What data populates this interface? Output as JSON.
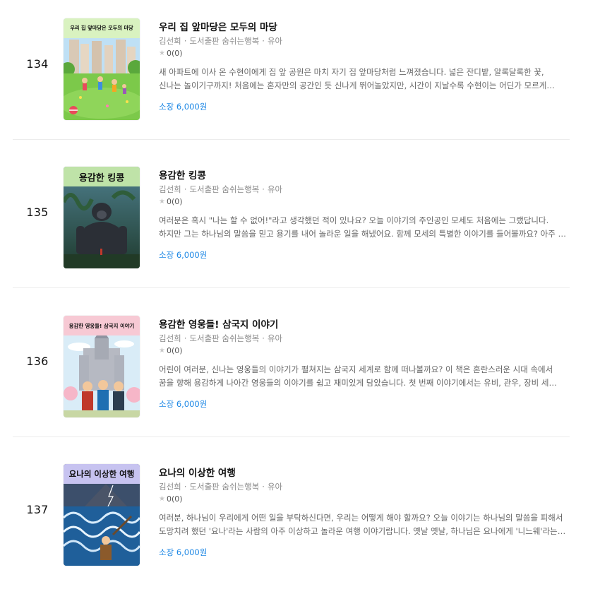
{
  "colors": {
    "accent": "#1e88e5",
    "meta": "#8a8a8a",
    "star_empty": "#c8c8c8",
    "band_green": "#bfe3a8",
    "band_pink": "#f7c9d4",
    "band_lavender": "#c7c3f0"
  },
  "books": [
    {
      "rank": "134",
      "title": "우리 집 앞마당은 모두의 마당",
      "author": "김선희",
      "publisher": "도서출판 숨쉬는행복",
      "category": "유아",
      "rating": "0(0)",
      "description": "새 아파트에 이사 온 수현이에게 집 앞 공원은 마치 자기 집 앞마당처럼 느껴졌습니다. 넓은 잔디밭, 알록달록한 꽃, 신나는 놀이기구까지! 처음에는 혼자만의 공간인 듯 신나게 뛰어놀았지만, 시간이 지날수록 수현이는 어딘가 모르게 심심함을…",
      "price": "소장 6,000원",
      "cover_title": "우리 집 앞마당은 모두의 마당",
      "cover_icon": "playground-illustration"
    },
    {
      "rank": "135",
      "title": "용감한 킹콩",
      "author": "김선희",
      "publisher": "도서출판 숨쉬는행복",
      "category": "유아",
      "rating": "0(0)",
      "description": "여러분은 혹시 \"나는 할 수 없어!\"라고 생각했던 적이 있나요? 오늘 이야기의 주인공인 모세도 처음에는 그랬답니다. 하지만 그는 하나님의 말씀을 믿고 용기를 내어 놀라운 일을 해냈어요. 함께 모세의 특별한 이야기를 들어볼까요? 아주 먼 옛날,…",
      "price": "소장 6,000원",
      "cover_title": "용감한 킹콩",
      "cover_icon": "gorilla-illustration"
    },
    {
      "rank": "136",
      "title": "용감한 영웅들! 삼국지 이야기",
      "author": "김선희",
      "publisher": "도서출판 숨쉬는행복",
      "category": "유아",
      "rating": "0(0)",
      "description": "어린이 여러분, 신나는 영웅들의 이야기가 펼쳐지는 삼국지 세계로 함께 떠나볼까요? 이 책은 혼란스러운 시대 속에서 꿈을 향해 용감하게 나아간 영웅들의 이야기를 쉽고 재미있게 담았습니다. 첫 번째 이야기에서는 유비, 관우, 장비 세 친구가…",
      "price": "소장 6,000원",
      "cover_title": "용감한 영웅들! 삼국지 이야기",
      "cover_icon": "castle-heroes-illustration"
    },
    {
      "rank": "137",
      "title": "요나의 이상한 여행",
      "author": "김선희",
      "publisher": "도서출판 숨쉬는행복",
      "category": "유아",
      "rating": "0(0)",
      "description": "여러분, 하나님이 우리에게 어떤 일을 부탁하신다면, 우리는 어떻게 해야 할까요? 오늘 이야기는 하나님의 말씀을 피해서 도망치려 했던 '요나'라는 사람의 아주 이상하고 놀라운 여행 이야기랍니다. 옛날 옛날, 하나님은 요나에게 '니느웨'라는 큰…",
      "price": "소장 6,000원",
      "cover_title": "요나의 이상한 여행",
      "cover_icon": "stormy-sea-illustration"
    }
  ]
}
